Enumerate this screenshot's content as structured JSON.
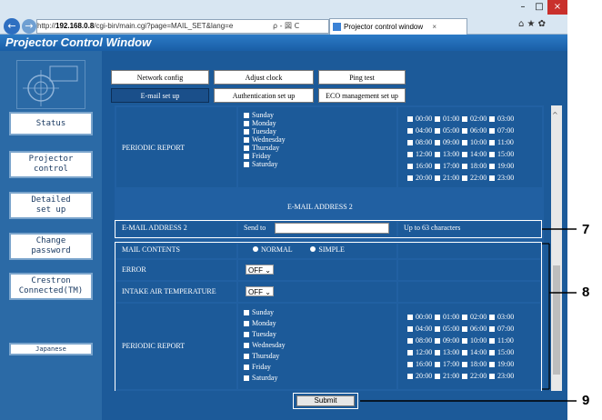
{
  "browser": {
    "address_prefix": "http://",
    "address_host": "192.168.0.8",
    "address_path": "/cgi-bin/main.cgi?page=MAIL_SET&lang=e",
    "search_glyph": "ρ - 図 C",
    "tab_title": "Projector control window",
    "tab_close": "×",
    "win_min": "–",
    "win_max": "□",
    "win_close": "×",
    "toolbar_icons": "⌂ ★ ✿",
    "back": "←",
    "forward": "→"
  },
  "app": {
    "title": "Projector Control Window",
    "sidebar": [
      "Status",
      "Projector\ncontrol",
      "Detailed\nset up",
      "Change\npassword",
      "Crestron\nConnected(TM)",
      "Japanese"
    ],
    "tabs_row1": [
      "Network config",
      "Adjust clock",
      "Ping test"
    ],
    "tabs_row2": [
      "E-mail set up",
      "Authentication set up",
      "ECO management set up"
    ]
  },
  "form": {
    "periodic_label": "PERIODIC REPORT",
    "days": [
      "Sunday",
      "Monday",
      "Tuesday",
      "Wednesday",
      "Thursday",
      "Friday",
      "Saturday"
    ],
    "hours": [
      [
        "00:00",
        "01:00",
        "02:00",
        "03:00"
      ],
      [
        "04:00",
        "05:00",
        "06:00",
        "07:00"
      ],
      [
        "08:00",
        "09:00",
        "10:00",
        "11:00"
      ],
      [
        "12:00",
        "13:00",
        "14:00",
        "15:00"
      ],
      [
        "16:00",
        "17:00",
        "18:00",
        "19:00"
      ],
      [
        "20:00",
        "21:00",
        "22:00",
        "23:00"
      ]
    ],
    "section2_title": "E-MAIL ADDRESS 2",
    "email_label": "E-MAIL ADDRESS 2",
    "send_to": "Send to",
    "email_value": "",
    "limit_note": "Up to 63 characters",
    "mail_contents_label": "MAIL CONTENTS",
    "mail_normal": "NORMAL",
    "mail_simple": "SIMPLE",
    "error_label": "ERROR",
    "error_value": "OFF",
    "intake_label": "INTAKE AIR TEMPERATURE",
    "intake_value": "OFF",
    "submit": "Submit"
  },
  "callouts": [
    "7",
    "8",
    "9"
  ]
}
